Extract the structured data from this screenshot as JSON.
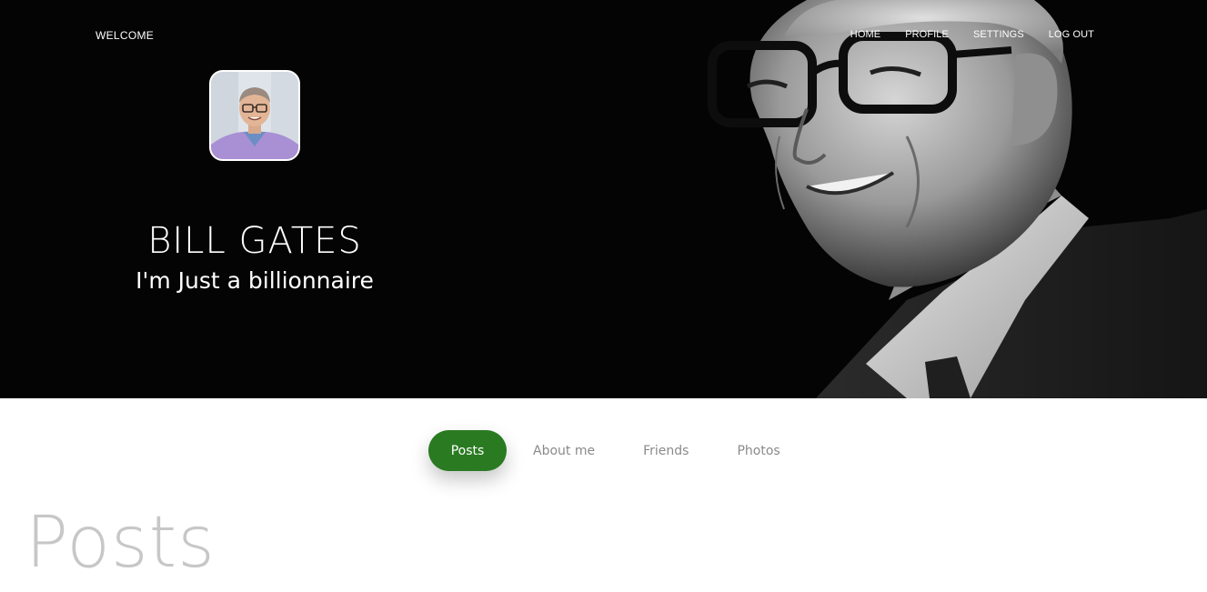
{
  "header": {
    "brand": "WELCOME",
    "nav": [
      {
        "label": "HOME"
      },
      {
        "label": "PROFILE"
      },
      {
        "label": "SETTINGS"
      },
      {
        "label": "LOG OUT"
      }
    ]
  },
  "profile": {
    "name": "BILL GATES",
    "tagline": "I'm Just a billionnaire"
  },
  "tabs": [
    {
      "label": "Posts",
      "active": true
    },
    {
      "label": "About me",
      "active": false
    },
    {
      "label": "Friends",
      "active": false
    },
    {
      "label": "Photos",
      "active": false
    }
  ],
  "section": {
    "title": "Posts"
  },
  "colors": {
    "hero_bg": "#050405",
    "accent": "#2a7a22",
    "muted_text": "#8a8a8a",
    "section_title": "#c7c7c7"
  }
}
